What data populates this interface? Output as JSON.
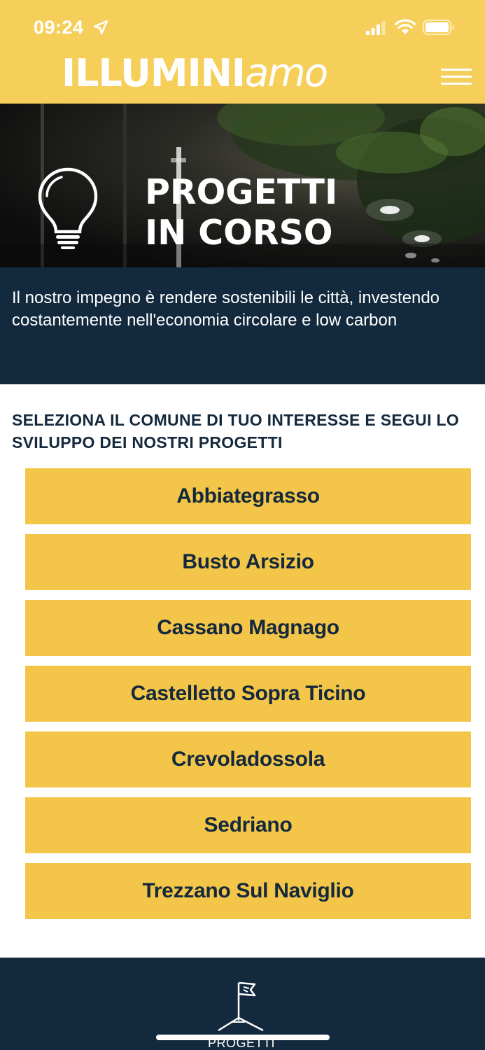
{
  "status_bar": {
    "time": "09:24",
    "icons": [
      "location-arrow-icon",
      "cellular-signal-icon",
      "wifi-icon",
      "battery-icon"
    ]
  },
  "header": {
    "logo_bold": "ILLUMINI",
    "logo_light": "amo",
    "menu_icon": "hamburger-menu-icon"
  },
  "hero": {
    "title_line1": "PROGETTI",
    "title_line2": "IN CORSO",
    "icon": "light-bulb-icon"
  },
  "intro": {
    "text": "Il nostro impegno è rendere sostenibili le città, investendo costantemente nell'economia circolare e low carbon"
  },
  "selection": {
    "heading": "SELEZIONA IL COMUNE DI TUO INTERESSE E SEGUI LO SVILUPPO DEI NOSTRI PROGETTI",
    "cities": [
      "Abbiategrasso",
      "Busto Arsizio",
      "Cassano Magnago",
      "Castelletto Sopra Ticino",
      "Crevoladossola",
      "Sedriano",
      "Trezzano Sul Naviglio"
    ]
  },
  "bottom_nav": {
    "label": "PROGETTI",
    "icon": "flag-icon"
  },
  "colors": {
    "header_yellow": "#f6cf5b",
    "button_yellow": "#f3c548",
    "navy": "#132a3e",
    "text_dark": "#14293d"
  }
}
